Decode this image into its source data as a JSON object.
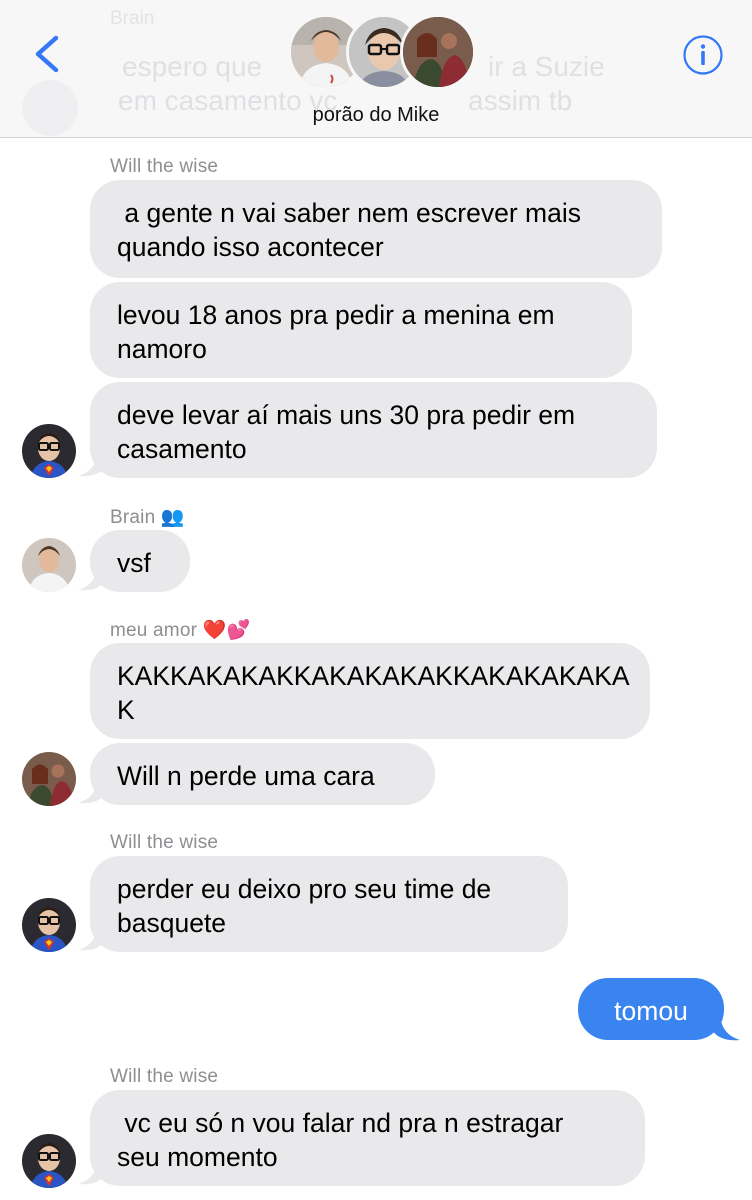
{
  "header": {
    "title": "porão do Mike",
    "ghost_sender": "Brain",
    "ghost_text_1": "espero que",
    "ghost_text_2": "ir a Suzie",
    "ghost_text_3": "em casamento vc",
    "ghost_text_4": "assim tb",
    "back_icon": "chevron-left-icon",
    "info_icon": "info-icon",
    "accent": "#3478f6"
  },
  "messages": {
    "s1": "Will the wise",
    "m1": " a gente n vai saber nem escrever mais\nquando isso acontecer",
    "m2": "levou 18 anos pra pedir a menina em\nnamoro",
    "m3": "deve levar aí mais uns 30 pra pedir em\ncasamento",
    "s2": "Brain 👥",
    "m4": "vsf",
    "s3": "meu amor ❤️💕",
    "m5": "KAKKAKAKAKKAKAKAKAKKAKAKAKAKA\nK",
    "m6": "Will n perde uma cara",
    "s4": "Will the wise",
    "m7": "perder eu deixo pro seu time de\nbasquete",
    "m8": "tomou",
    "s5": "Will the wise",
    "m9": " vc eu só n vou falar nd pra n estragar\nseu momento"
  },
  "colors": {
    "incoming_bubble": "#e9e9eb",
    "outgoing_bubble": "#3a84f0",
    "sender_label": "#8e8e93"
  }
}
